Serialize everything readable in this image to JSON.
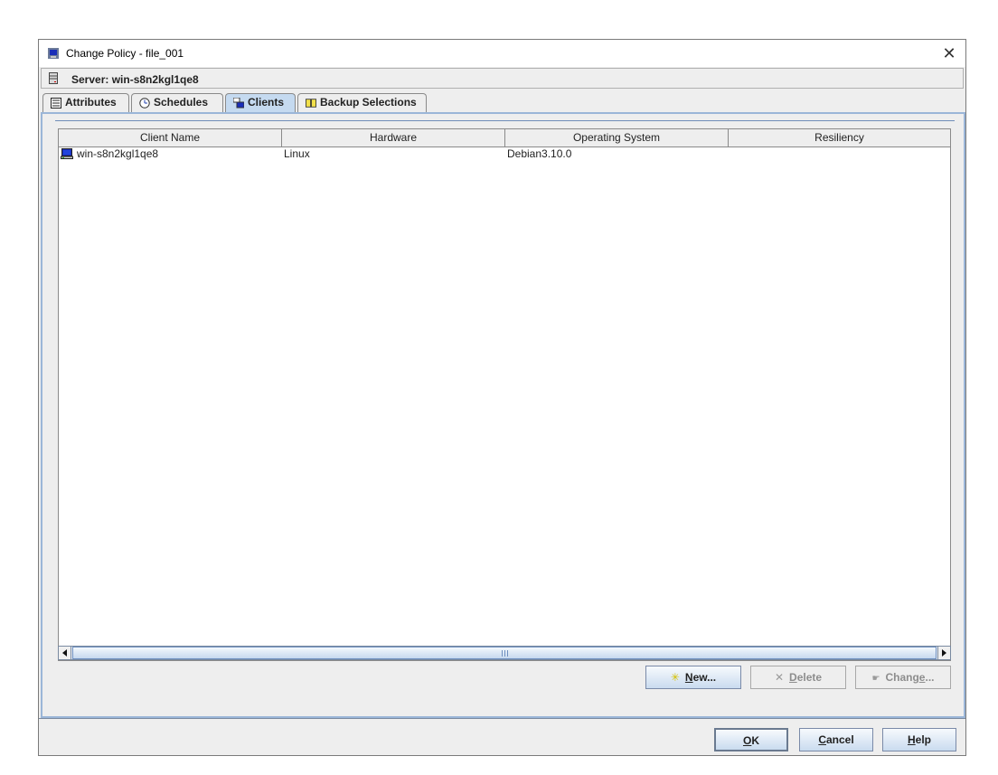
{
  "window": {
    "title": "Change Policy - file_001",
    "close_icon": "close-icon"
  },
  "server": {
    "label": "Server: win-s8n2kgl1qe8",
    "icon": "server-icon"
  },
  "tabs": [
    {
      "label": "Attributes",
      "icon": "attributes-icon",
      "active": false
    },
    {
      "label": "Schedules",
      "icon": "schedules-icon",
      "active": false
    },
    {
      "label": "Clients",
      "icon": "clients-icon",
      "active": true
    },
    {
      "label": "Backup Selections",
      "icon": "backup-selections-icon",
      "active": false
    }
  ],
  "clients_table": {
    "columns": [
      "Client Name",
      "Hardware",
      "Operating System",
      "Resiliency"
    ],
    "rows": [
      {
        "client_name": "win-s8n2kgl1qe8",
        "hardware": "Linux",
        "operating_system": "Debian3.10.0",
        "resiliency": "",
        "icon": "computer-icon"
      }
    ]
  },
  "panel_buttons": {
    "new": {
      "prefix": "",
      "mnemonic": "N",
      "suffix": "ew...",
      "enabled": true
    },
    "delete": {
      "prefix": "",
      "mnemonic": "D",
      "suffix": "elete",
      "enabled": false
    },
    "change": {
      "prefix": "Chang",
      "mnemonic": "e",
      "suffix": "...",
      "enabled": false
    }
  },
  "dialog_buttons": {
    "ok": {
      "prefix": "",
      "mnemonic": "O",
      "suffix": "K"
    },
    "cancel": {
      "prefix": "",
      "mnemonic": "C",
      "suffix": "ancel"
    },
    "help": {
      "prefix": "",
      "mnemonic": "H",
      "suffix": "elp"
    }
  },
  "colors": {
    "active_tab": "#c5daf0",
    "accent_border": "#9bb6d8"
  }
}
